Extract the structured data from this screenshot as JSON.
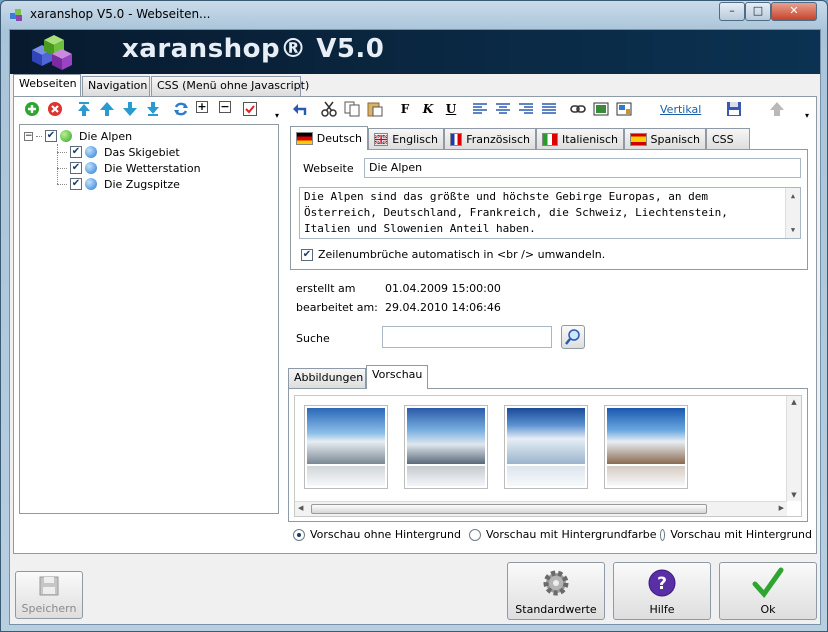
{
  "window": {
    "title": "xaranshop V5.0 - Webseiten..."
  },
  "banner": {
    "brand": "xaranshop® V5.0"
  },
  "main_tabs": [
    {
      "label": "Webseiten"
    },
    {
      "label": "Navigation"
    },
    {
      "label": "CSS (Menü ohne Javascript)"
    }
  ],
  "left_toolbar": [
    "add-icon",
    "delete-icon",
    "move-top-icon",
    "move-up-icon",
    "move-down-icon",
    "move-bottom-icon",
    "refresh-icon",
    "expand-icon",
    "collapse-icon",
    "check-icon"
  ],
  "editor_toolbar": {
    "link_label": "Vertikal",
    "icons": [
      "undo-icon",
      "cut-icon",
      "copy-icon",
      "paste-icon",
      "bold-icon",
      "italic-icon",
      "underline-icon",
      "align-left-icon",
      "align-center-icon",
      "align-right-icon",
      "align-justify-icon",
      "link-icon",
      "image-icon",
      "insert-icon",
      "save-icon",
      "up-icon"
    ]
  },
  "tree": {
    "root": {
      "label": "Die Alpen",
      "checked": true
    },
    "children": [
      {
        "label": "Das Skigebiet",
        "checked": true
      },
      {
        "label": "Die Wetterstation",
        "checked": true
      },
      {
        "label": "Die Zugspitze",
        "checked": true
      }
    ]
  },
  "language_tabs": [
    {
      "label": "Deutsch",
      "flag": "de"
    },
    {
      "label": "Englisch",
      "flag": "gb"
    },
    {
      "label": "Französisch",
      "flag": "fr"
    },
    {
      "label": "Italienisch",
      "flag": "it"
    },
    {
      "label": "Spanisch",
      "flag": "es"
    },
    {
      "label": "CSS",
      "flag": ""
    }
  ],
  "form": {
    "webseite_label": "Webseite",
    "webseite_value": "Die Alpen",
    "description_lines": [
      "Die Alpen sind das größte und höchste Gebirge Europas, an dem",
      "Österreich, Deutschland, Frankreich, die Schweiz, Liechtenstein,",
      "Italien und Slowenien Anteil haben."
    ],
    "linebreak_checkbox": "Zeilenumbrüche automatisch in <br /> umwandeln.",
    "created_label": "erstellt am",
    "created_value": "01.04.2009 15:00:00",
    "edited_label": "bearbeitet am:",
    "edited_value": "29.04.2010 14:06:46",
    "search_label": "Suche",
    "search_value": ""
  },
  "preview_tabs": [
    {
      "label": "Abbildungen"
    },
    {
      "label": "Vorschau"
    }
  ],
  "thumbnails": [
    {
      "name": "thumbnail-1"
    },
    {
      "name": "thumbnail-2"
    },
    {
      "name": "thumbnail-3"
    },
    {
      "name": "thumbnail-4"
    }
  ],
  "preview_options": {
    "selected": "Vorschau ohne Hintergrund",
    "options": [
      "Vorschau ohne Hintergrund",
      "Vorschau mit Hintergrundfarbe",
      "Vorschau mit Hintergrund"
    ]
  },
  "buttons": {
    "save": "Speichern",
    "defaults": "Standardwerte",
    "help": "Hilfe",
    "ok": "Ok"
  },
  "colors": {
    "accent": "#1b5ea8",
    "banner": "#0a2944",
    "ok_green": "#2ea52e",
    "help_purple": "#5a2ea5"
  }
}
